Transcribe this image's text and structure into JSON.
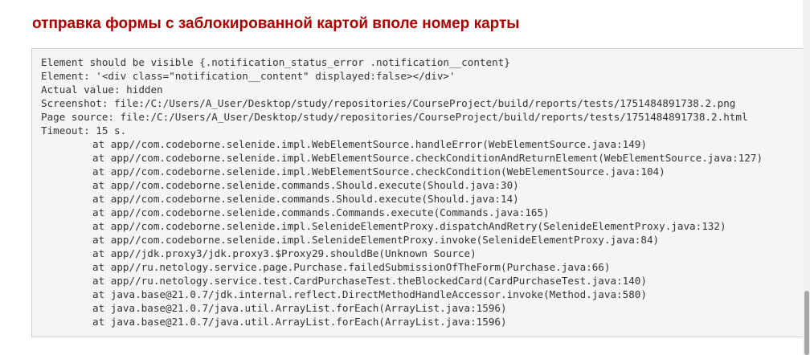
{
  "page": {
    "title": "отправка формы с заблокированной картой вполе номер карты",
    "title_color": "#b00000"
  },
  "trace": {
    "header_lines": [
      "Element should be visible {.notification_status_error .notification__content}",
      "Element: '<div class=\"notification__content\" displayed:false></div>'",
      "Actual value: hidden",
      "Screenshot: file:/C:/Users/A_User/Desktop/study/repositories/CourseProject/build/reports/tests/1751484891738.2.png",
      "Page source: file:/C:/Users/A_User/Desktop/study/repositories/CourseProject/build/reports/tests/1751484891738.2.html",
      "Timeout: 15 s."
    ],
    "stack_lines": [
      "at app//com.codeborne.selenide.impl.WebElementSource.handleError(WebElementSource.java:149)",
      "at app//com.codeborne.selenide.impl.WebElementSource.checkConditionAndReturnElement(WebElementSource.java:127)",
      "at app//com.codeborne.selenide.impl.WebElementSource.checkCondition(WebElementSource.java:104)",
      "at app//com.codeborne.selenide.commands.Should.execute(Should.java:30)",
      "at app//com.codeborne.selenide.commands.Should.execute(Should.java:14)",
      "at app//com.codeborne.selenide.commands.Commands.execute(Commands.java:165)",
      "at app//com.codeborne.selenide.impl.SelenideElementProxy.dispatchAndRetry(SelenideElementProxy.java:132)",
      "at app//com.codeborne.selenide.impl.SelenideElementProxy.invoke(SelenideElementProxy.java:84)",
      "at app//jdk.proxy3/jdk.proxy3.$Proxy29.shouldBe(Unknown Source)",
      "at app//ru.netology.service.page.Purchase.failedSubmissionOfTheForm(Purchase.java:66)",
      "at app//ru.netology.service.test.CardPurchaseTest.theBlockedCard(CardPurchaseTest.java:140)",
      "at java.base@21.0.7/jdk.internal.reflect.DirectMethodHandleAccessor.invoke(Method.java:580)",
      "at java.base@21.0.7/java.util.ArrayList.forEach(ArrayList.java:1596)",
      "at java.base@21.0.7/java.util.ArrayList.forEach(ArrayList.java:1596)"
    ]
  }
}
